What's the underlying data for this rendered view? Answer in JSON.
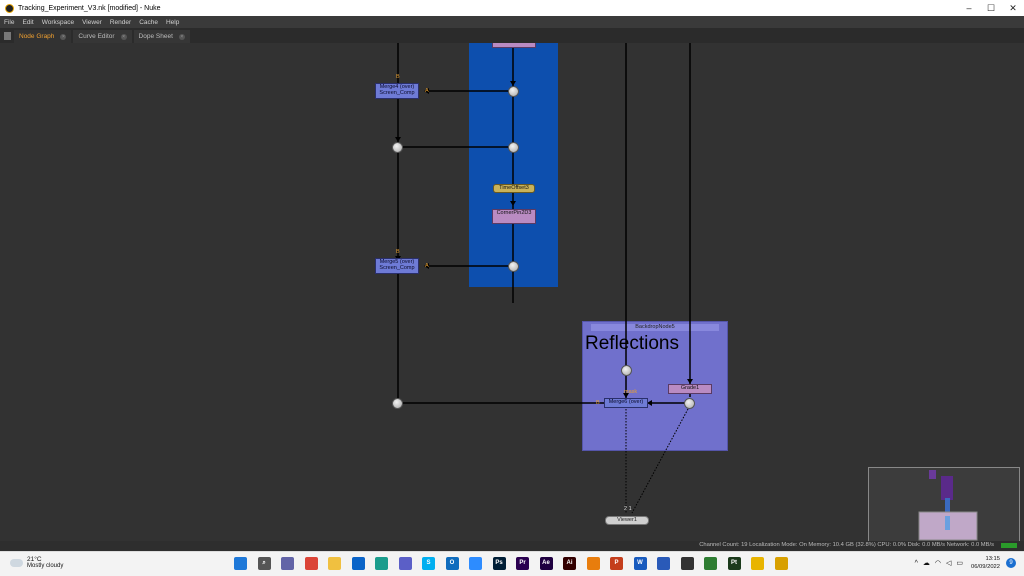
{
  "window": {
    "title": "Tracking_Experiment_V3.nk [modified] - Nuke",
    "minimize": "–",
    "maximize": "☐",
    "close": "✕"
  },
  "menu": [
    "File",
    "Edit",
    "Workspace",
    "Viewer",
    "Render",
    "Cache",
    "Help"
  ],
  "tabs": [
    {
      "label": "Node Graph",
      "active": true
    },
    {
      "label": "Curve Editor",
      "active": false
    },
    {
      "label": "Dope Sheet",
      "active": false
    }
  ],
  "nodes": {
    "merge4": "Merge4 (over) Screen_Comp",
    "merge5": "Merge5 (over) Screen_Comp",
    "timeoffset3": "TimeOffset3",
    "cornerpin": "CornerPin2D3",
    "merge_bottom": "Merge6 (over)",
    "grade": "Grade1",
    "viewer": "Viewer1"
  },
  "pins": {
    "b": "B",
    "a": "A",
    "mask": "mask",
    "viewer_inputs": "2 1"
  },
  "backdrop": {
    "name": "BackdropNode5",
    "label": "Reflections"
  },
  "status": {
    "text": "Channel Count: 19  Localization Mode: On  Memory: 10.4 GB (32.8%)  CPU: 0.0%  Disk: 0.0 MB/s  Network: 0.0 MB/s"
  },
  "taskbar": {
    "weather_temp": "21°C",
    "weather_desc": "Mostly cloudy",
    "time": "13:15",
    "date": "06/09/2022",
    "notifications": "9",
    "apps": [
      {
        "name": "start",
        "label": "",
        "color": "#1e78d8"
      },
      {
        "name": "search",
        "label": "⌕",
        "color": "#555555"
      },
      {
        "name": "teams-chat",
        "label": "",
        "color": "#6264a7"
      },
      {
        "name": "chrome",
        "label": "",
        "color": "#db4437"
      },
      {
        "name": "files",
        "label": "",
        "color": "#f0c040"
      },
      {
        "name": "mail",
        "label": "",
        "color": "#0a64c8"
      },
      {
        "name": "edge",
        "label": "",
        "color": "#1a9c8c"
      },
      {
        "name": "teams",
        "label": "",
        "color": "#5b5fc7"
      },
      {
        "name": "skype",
        "label": "S",
        "color": "#00aff0"
      },
      {
        "name": "outlook",
        "label": "O",
        "color": "#0f6cbd"
      },
      {
        "name": "zoom",
        "label": "",
        "color": "#2d8cff"
      },
      {
        "name": "photoshop",
        "label": "Ps",
        "color": "#001e36"
      },
      {
        "name": "premiere",
        "label": "Pr",
        "color": "#2a0050"
      },
      {
        "name": "after-effects",
        "label": "Ae",
        "color": "#1f0040"
      },
      {
        "name": "illustrator",
        "label": "Ai",
        "color": "#330000"
      },
      {
        "name": "blender",
        "label": "",
        "color": "#e87d0d"
      },
      {
        "name": "powerpoint",
        "label": "P",
        "color": "#c43e1c"
      },
      {
        "name": "word",
        "label": "W",
        "color": "#185abd"
      },
      {
        "name": "app-blue",
        "label": "",
        "color": "#2a5ab8"
      },
      {
        "name": "app-ps",
        "label": "",
        "color": "#333333"
      },
      {
        "name": "app-green",
        "label": "",
        "color": "#2e7d32"
      },
      {
        "name": "painter",
        "label": "Pt",
        "color": "#1b3a1b"
      },
      {
        "name": "nuke-1",
        "label": "",
        "color": "#e8b400"
      },
      {
        "name": "nuke-2",
        "label": "",
        "color": "#d8a000"
      }
    ]
  }
}
